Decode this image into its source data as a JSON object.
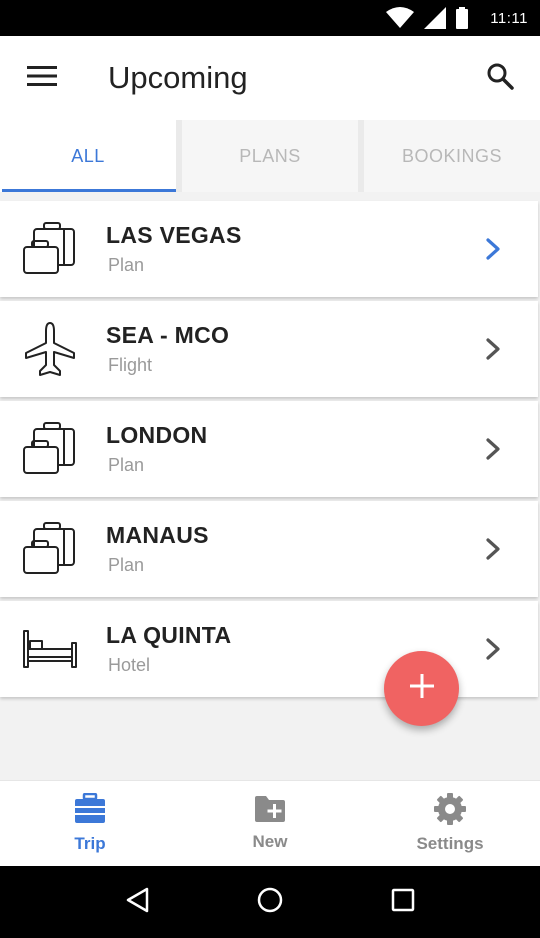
{
  "status_bar": {
    "time": "11:11",
    "icons": [
      "wifi-icon",
      "signal-icon",
      "battery-icon"
    ]
  },
  "app_bar": {
    "title": "Upcoming",
    "menu_icon": "menu-icon",
    "search_icon": "search-icon"
  },
  "tabs": [
    {
      "label": "ALL",
      "active": true
    },
    {
      "label": "PLANS",
      "active": false
    },
    {
      "label": "BOOKINGS",
      "active": false
    }
  ],
  "items": [
    {
      "title": "LAS VEGAS",
      "subtitle": "Plan",
      "icon": "luggage-icon",
      "chevron_color": "#3c78d8"
    },
    {
      "title": "SEA - MCO",
      "subtitle": "Flight",
      "icon": "airplane-icon",
      "chevron_color": "#555555"
    },
    {
      "title": "LONDON",
      "subtitle": "Plan",
      "icon": "luggage-icon",
      "chevron_color": "#555555"
    },
    {
      "title": "MANAUS",
      "subtitle": "Plan",
      "icon": "luggage-icon",
      "chevron_color": "#555555"
    },
    {
      "title": "LA QUINTA",
      "subtitle": "Hotel",
      "icon": "bed-icon",
      "chevron_color": "#555555"
    }
  ],
  "fab": {
    "icon": "plus-icon",
    "color": "#f06362"
  },
  "bottom_nav": [
    {
      "label": "Trip",
      "icon": "briefcase-icon",
      "active": true
    },
    {
      "label": "New",
      "icon": "folder-add-icon",
      "active": false
    },
    {
      "label": "Settings",
      "icon": "gear-icon",
      "active": false
    }
  ],
  "colors": {
    "accent": "#3c78d8",
    "fab": "#f06362"
  }
}
